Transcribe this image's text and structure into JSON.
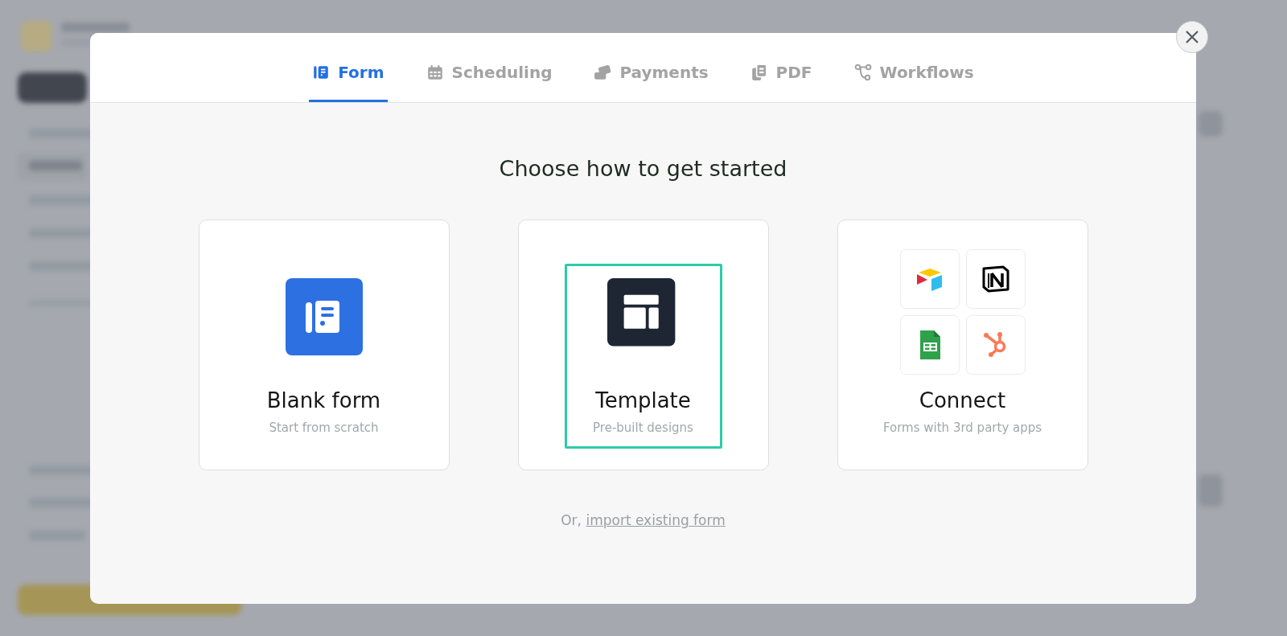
{
  "tabs": [
    {
      "label": "Form",
      "kind": "form",
      "selected": true
    },
    {
      "label": "Scheduling",
      "kind": "calendar",
      "selected": false
    },
    {
      "label": "Payments",
      "kind": "cards",
      "selected": false
    },
    {
      "label": "PDF",
      "kind": "pdf",
      "selected": false
    },
    {
      "label": "Workflows",
      "kind": "workflow",
      "selected": false
    }
  ],
  "heading": "Choose how to get started",
  "options": [
    {
      "title": "Blank form",
      "subtitle": "Start from scratch",
      "kind": "blank",
      "selected": false
    },
    {
      "title": "Template",
      "subtitle": "Pre-built designs",
      "kind": "template",
      "selected": true
    },
    {
      "title": "Connect",
      "subtitle": "Forms with 3rd party apps",
      "kind": "connect",
      "selected": false
    }
  ],
  "import_prefix": "Or,",
  "import_link": "import existing form"
}
